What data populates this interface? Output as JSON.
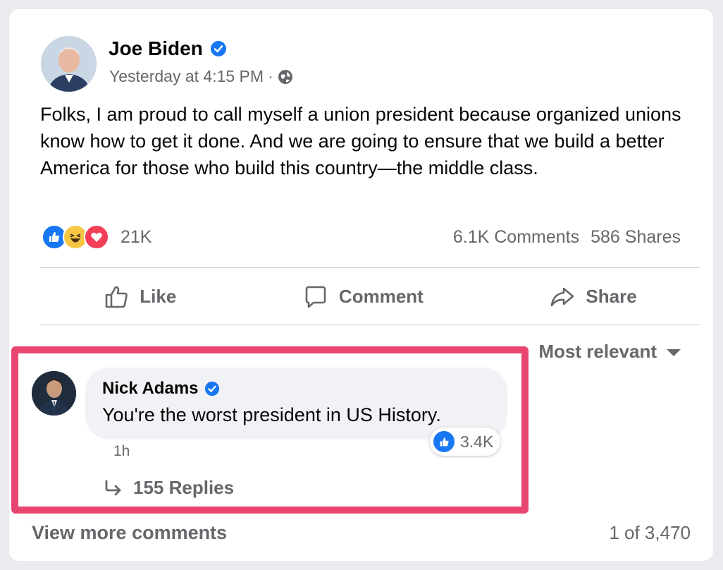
{
  "post": {
    "author": "Joe Biden",
    "timestamp": "Yesterday at 4:15 PM",
    "separator": "·",
    "visibility_icon": "globe-icon",
    "text": "Folks, I am proud to call myself a union president because organized unions know how to get it done. And we are going to ensure that we build a better America for those who build this country—the middle class.",
    "reaction_icons": [
      "like-reaction-icon",
      "haha-reaction-icon",
      "love-reaction-icon"
    ],
    "reaction_count": "21K",
    "comments_count": "6.1K Comments",
    "shares_count": "586 Shares"
  },
  "actions": {
    "like": "Like",
    "comment": "Comment",
    "share": "Share"
  },
  "sort_label": "Most relevant",
  "comment": {
    "author": "Nick Adams",
    "text": "You're the worst president in US History.",
    "time": "1h",
    "like_count": "3.4K",
    "replies": "155 Replies"
  },
  "footer": {
    "view_more": "View more comments",
    "pager": "1 of 3,470"
  },
  "colors": {
    "brand_blue": "#1877f2",
    "highlight": "#e84670",
    "secondary_text": "#65676b"
  }
}
